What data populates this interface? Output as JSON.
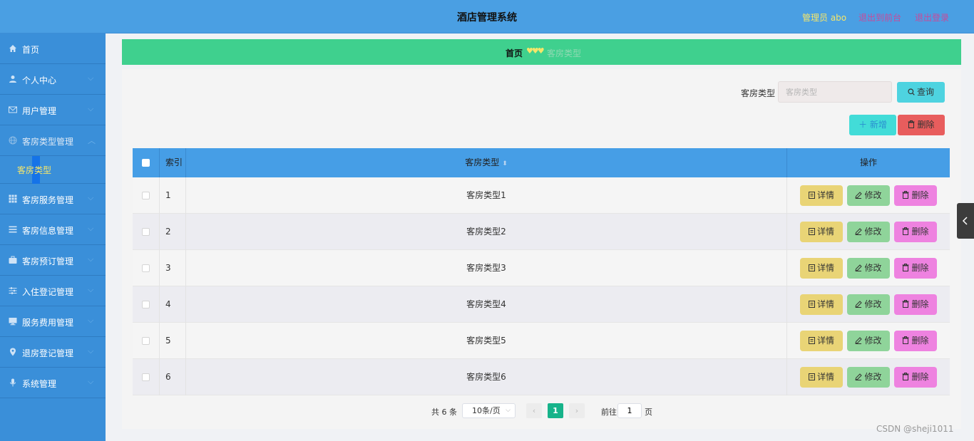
{
  "header": {
    "title": "酒店管理系统",
    "user": "管理员 abo",
    "back_link": "退出到前台",
    "logout_link": "退出登录"
  },
  "sidebar": {
    "items": [
      {
        "label": "首页",
        "icon": "home-icon"
      },
      {
        "label": "个人中心",
        "icon": "user-icon"
      },
      {
        "label": "用户管理",
        "icon": "mail-icon"
      },
      {
        "label": "客房类型管理",
        "icon": "globe-icon",
        "open": true,
        "sub": "客房类型"
      },
      {
        "label": "客房服务管理",
        "icon": "grid-icon"
      },
      {
        "label": "客房信息管理",
        "icon": "list-icon"
      },
      {
        "label": "客房预订管理",
        "icon": "briefcase-icon"
      },
      {
        "label": "入住登记管理",
        "icon": "sliders-icon"
      },
      {
        "label": "服务费用管理",
        "icon": "monitor-icon"
      },
      {
        "label": "退房登记管理",
        "icon": "location-icon"
      },
      {
        "label": "系统管理",
        "icon": "mic-icon"
      }
    ]
  },
  "breadcrumb": {
    "home": "首页",
    "hearts": "♥♥♥",
    "current": "客房类型"
  },
  "search": {
    "label": "客房类型",
    "placeholder": "客房类型",
    "query_label": "查询"
  },
  "toolbar": {
    "add_label": "新增",
    "delete_label": "删除"
  },
  "table": {
    "headers": {
      "index": "索引",
      "type": "客房类型",
      "actions": "操作"
    },
    "rows": [
      {
        "index": "1",
        "type": "客房类型1"
      },
      {
        "index": "2",
        "type": "客房类型2"
      },
      {
        "index": "3",
        "type": "客房类型3"
      },
      {
        "index": "4",
        "type": "客房类型4"
      },
      {
        "index": "5",
        "type": "客房类型5"
      },
      {
        "index": "6",
        "type": "客房类型6"
      }
    ],
    "actions": {
      "detail": "详情",
      "edit": "修改",
      "delete": "删除"
    }
  },
  "pagination": {
    "total": "共 6 条",
    "page_size": "10条/页",
    "current_page": "1",
    "goto_label": "前往",
    "goto_value": "1",
    "page_suffix": "页"
  },
  "watermark": "CSDN @sheji1011"
}
